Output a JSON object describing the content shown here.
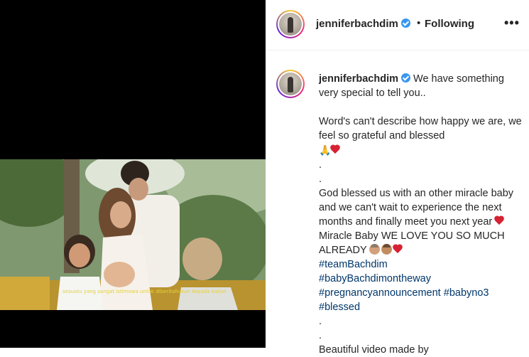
{
  "post": {
    "username": "jenniferbachdim",
    "follow_separator": "•",
    "follow_status": "Following",
    "more_label": "•••"
  },
  "video": {
    "subtitle": "sesuatu yang sangat istimewa untuk diberitahukan kepada kalian"
  },
  "caption": {
    "username": "jenniferbachdim",
    "line1_text": "We have something very special to tell you..",
    "line2_text": "Word's can't describe how happy we are, we feel so grateful and blessed",
    "line2_emoji": "🙏",
    "dot1": ".",
    "dot2": ".",
    "line3_text": "God blessed us with an other miracle baby and we can't wait to experience the next months and finally meet you next year",
    "line3b_text": "Miracle Baby WE LOVE YOU SO MUCH ALREADY",
    "hashtag1": "#teamBachdim",
    "hashtag2": "#babyBachdimontheway",
    "hashtag3": "#pregnancyannouncement",
    "hashtag4": "#babyno3",
    "hashtag5": "#blessed",
    "dot3": ".",
    "dot4": ".",
    "line4_text": "Beautiful video made by"
  },
  "icons": {
    "verified": "verified-badge-icon",
    "heart": "red-heart-icon",
    "pray": "folded-hands-icon",
    "baby": "baby-face-icon",
    "girl": "girl-face-icon"
  },
  "colors": {
    "verified": "#3897f0",
    "hashtag": "#00376b",
    "heart": "#d62233",
    "subtitle": "#e4d23a"
  }
}
